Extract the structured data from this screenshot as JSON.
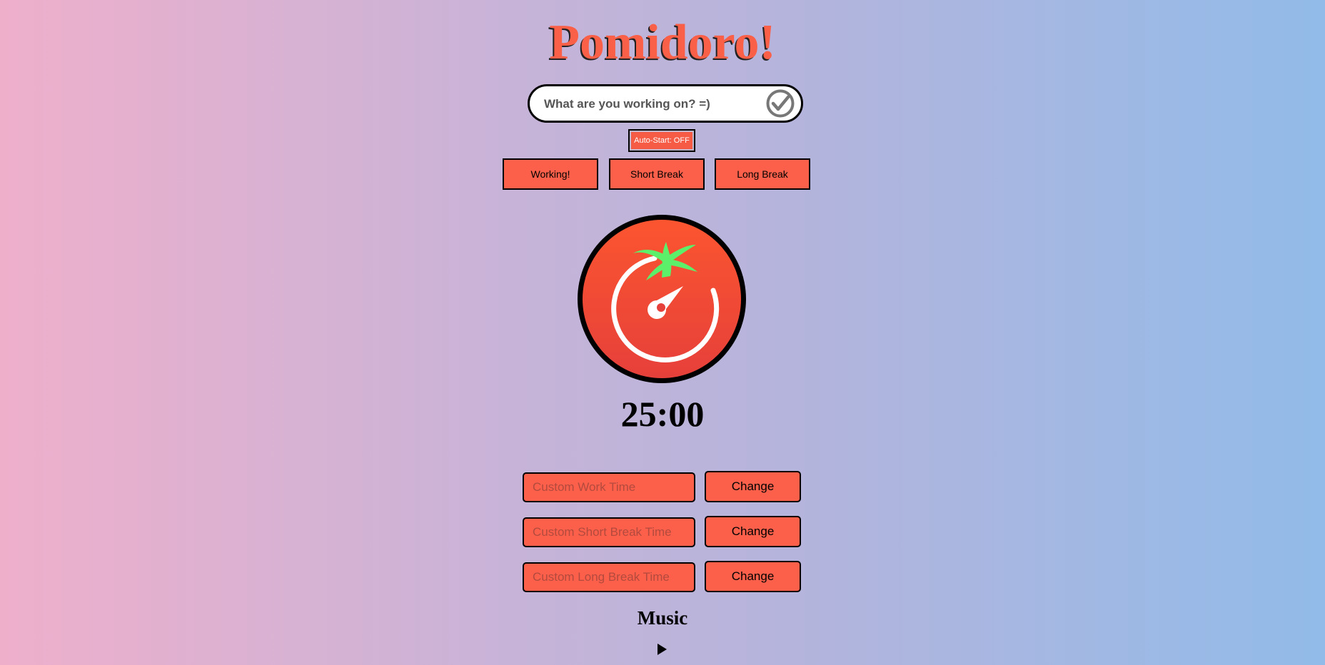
{
  "app": {
    "title": "Pomidoro!"
  },
  "task": {
    "placeholder": "What are you working on? =)",
    "submit_icon": "check-circle-icon"
  },
  "auto_start": {
    "label": "Auto-Start: OFF"
  },
  "modes": [
    {
      "label": "Working!"
    },
    {
      "label": "Short Break"
    },
    {
      "label": "Long Break"
    }
  ],
  "timer": {
    "display": "25:00",
    "icon": "tomato-timer-icon"
  },
  "custom_times": [
    {
      "placeholder": "Custom Work Time",
      "button_label": "Change"
    },
    {
      "placeholder": "Custom Short Break Time",
      "button_label": "Change"
    },
    {
      "placeholder": "Custom Long Break Time",
      "button_label": "Change"
    }
  ],
  "music": {
    "heading": "Music",
    "play_icon": "play-icon"
  },
  "colors": {
    "accent": "#fd604a",
    "title": "#fa5f47",
    "leaf": "#5cf06a",
    "gradient_left": "#eeafcb",
    "gradient_right": "#92bbe9"
  }
}
